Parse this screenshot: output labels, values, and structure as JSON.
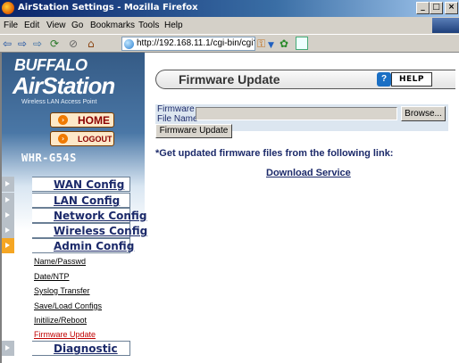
{
  "window": {
    "title": "AirStation Settings - Mozilla Firefox"
  },
  "menu": {
    "items": [
      "File",
      "Edit",
      "View",
      "Go",
      "Bookmarks",
      "Tools",
      "Help"
    ]
  },
  "toolbar": {
    "url": "http://192.168.11.1/cgi-bin/cgi?"
  },
  "sidebar": {
    "logo_top": "BUFFALO",
    "logo_main": "AirStation",
    "logo_sub": "Wireless LAN Access Point",
    "home_label": "HOME",
    "logout_label": "LOGOUT",
    "model": "WHR-G54S",
    "nav": [
      {
        "label": "WAN Config",
        "active": false
      },
      {
        "label": "LAN Config",
        "active": false
      },
      {
        "label": "Network Config",
        "active": false
      },
      {
        "label": "Wireless Config",
        "active": false
      },
      {
        "label": "Admin Config",
        "active": true
      }
    ],
    "admin_sub": [
      "Name/Passwd",
      "Date/NTP",
      "Syslog Transfer",
      "Save/Load Configs",
      "Initilize/Reboot",
      "Firmware Update"
    ],
    "admin_active": "Firmware Update",
    "diagnostic_label": "Diagnostic"
  },
  "main": {
    "title": "Firmware Update",
    "help_label": "HELP",
    "file_label_1": "Firmware",
    "file_label_2": "File Name",
    "file_value": "",
    "browse_label": "Browse...",
    "update_label": "Firmware Update",
    "info_text": "*Get updated firmware files from the following link:",
    "link_text": "Download Service"
  },
  "colors": {
    "accent_blue": "#1c2a6a",
    "active_orange": "#f5a623",
    "active_link": "#c00000"
  }
}
